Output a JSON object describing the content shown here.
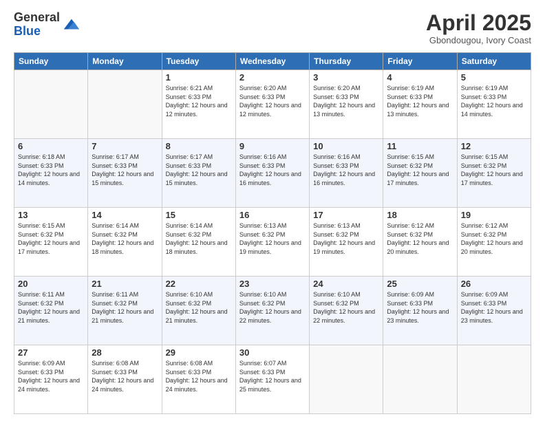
{
  "logo": {
    "line1": "General",
    "line2": "Blue"
  },
  "title": "April 2025",
  "subtitle": "Gbondougou, Ivory Coast",
  "days_of_week": [
    "Sunday",
    "Monday",
    "Tuesday",
    "Wednesday",
    "Thursday",
    "Friday",
    "Saturday"
  ],
  "weeks": [
    [
      {
        "day": "",
        "info": ""
      },
      {
        "day": "",
        "info": ""
      },
      {
        "day": "1",
        "info": "Sunrise: 6:21 AM\nSunset: 6:33 PM\nDaylight: 12 hours and 12 minutes."
      },
      {
        "day": "2",
        "info": "Sunrise: 6:20 AM\nSunset: 6:33 PM\nDaylight: 12 hours and 12 minutes."
      },
      {
        "day": "3",
        "info": "Sunrise: 6:20 AM\nSunset: 6:33 PM\nDaylight: 12 hours and 13 minutes."
      },
      {
        "day": "4",
        "info": "Sunrise: 6:19 AM\nSunset: 6:33 PM\nDaylight: 12 hours and 13 minutes."
      },
      {
        "day": "5",
        "info": "Sunrise: 6:19 AM\nSunset: 6:33 PM\nDaylight: 12 hours and 14 minutes."
      }
    ],
    [
      {
        "day": "6",
        "info": "Sunrise: 6:18 AM\nSunset: 6:33 PM\nDaylight: 12 hours and 14 minutes."
      },
      {
        "day": "7",
        "info": "Sunrise: 6:17 AM\nSunset: 6:33 PM\nDaylight: 12 hours and 15 minutes."
      },
      {
        "day": "8",
        "info": "Sunrise: 6:17 AM\nSunset: 6:33 PM\nDaylight: 12 hours and 15 minutes."
      },
      {
        "day": "9",
        "info": "Sunrise: 6:16 AM\nSunset: 6:33 PM\nDaylight: 12 hours and 16 minutes."
      },
      {
        "day": "10",
        "info": "Sunrise: 6:16 AM\nSunset: 6:33 PM\nDaylight: 12 hours and 16 minutes."
      },
      {
        "day": "11",
        "info": "Sunrise: 6:15 AM\nSunset: 6:32 PM\nDaylight: 12 hours and 17 minutes."
      },
      {
        "day": "12",
        "info": "Sunrise: 6:15 AM\nSunset: 6:32 PM\nDaylight: 12 hours and 17 minutes."
      }
    ],
    [
      {
        "day": "13",
        "info": "Sunrise: 6:15 AM\nSunset: 6:32 PM\nDaylight: 12 hours and 17 minutes."
      },
      {
        "day": "14",
        "info": "Sunrise: 6:14 AM\nSunset: 6:32 PM\nDaylight: 12 hours and 18 minutes."
      },
      {
        "day": "15",
        "info": "Sunrise: 6:14 AM\nSunset: 6:32 PM\nDaylight: 12 hours and 18 minutes."
      },
      {
        "day": "16",
        "info": "Sunrise: 6:13 AM\nSunset: 6:32 PM\nDaylight: 12 hours and 19 minutes."
      },
      {
        "day": "17",
        "info": "Sunrise: 6:13 AM\nSunset: 6:32 PM\nDaylight: 12 hours and 19 minutes."
      },
      {
        "day": "18",
        "info": "Sunrise: 6:12 AM\nSunset: 6:32 PM\nDaylight: 12 hours and 20 minutes."
      },
      {
        "day": "19",
        "info": "Sunrise: 6:12 AM\nSunset: 6:32 PM\nDaylight: 12 hours and 20 minutes."
      }
    ],
    [
      {
        "day": "20",
        "info": "Sunrise: 6:11 AM\nSunset: 6:32 PM\nDaylight: 12 hours and 21 minutes."
      },
      {
        "day": "21",
        "info": "Sunrise: 6:11 AM\nSunset: 6:32 PM\nDaylight: 12 hours and 21 minutes."
      },
      {
        "day": "22",
        "info": "Sunrise: 6:10 AM\nSunset: 6:32 PM\nDaylight: 12 hours and 21 minutes."
      },
      {
        "day": "23",
        "info": "Sunrise: 6:10 AM\nSunset: 6:32 PM\nDaylight: 12 hours and 22 minutes."
      },
      {
        "day": "24",
        "info": "Sunrise: 6:10 AM\nSunset: 6:32 PM\nDaylight: 12 hours and 22 minutes."
      },
      {
        "day": "25",
        "info": "Sunrise: 6:09 AM\nSunset: 6:33 PM\nDaylight: 12 hours and 23 minutes."
      },
      {
        "day": "26",
        "info": "Sunrise: 6:09 AM\nSunset: 6:33 PM\nDaylight: 12 hours and 23 minutes."
      }
    ],
    [
      {
        "day": "27",
        "info": "Sunrise: 6:09 AM\nSunset: 6:33 PM\nDaylight: 12 hours and 24 minutes."
      },
      {
        "day": "28",
        "info": "Sunrise: 6:08 AM\nSunset: 6:33 PM\nDaylight: 12 hours and 24 minutes."
      },
      {
        "day": "29",
        "info": "Sunrise: 6:08 AM\nSunset: 6:33 PM\nDaylight: 12 hours and 24 minutes."
      },
      {
        "day": "30",
        "info": "Sunrise: 6:07 AM\nSunset: 6:33 PM\nDaylight: 12 hours and 25 minutes."
      },
      {
        "day": "",
        "info": ""
      },
      {
        "day": "",
        "info": ""
      },
      {
        "day": "",
        "info": ""
      }
    ]
  ]
}
